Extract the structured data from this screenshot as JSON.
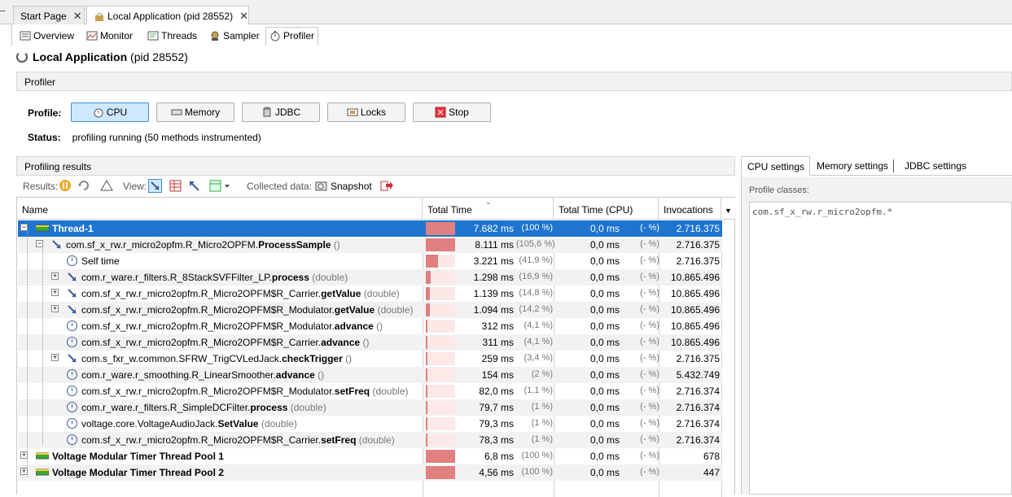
{
  "doc_tabs": [
    {
      "label": "Start Page",
      "close": "✕"
    },
    {
      "label": "Local Application (pid 28552)",
      "close": "✕"
    }
  ],
  "view_tabs": [
    "Overview",
    "Monitor",
    "Threads",
    "Sampler",
    "Profiler"
  ],
  "title": {
    "name": "Local Application",
    "pid": "(pid 28552)"
  },
  "profiler_section": "Profiler",
  "profile": {
    "label": "Profile:",
    "buttons": [
      "CPU",
      "Memory",
      "JDBC",
      "Locks",
      "Stop"
    ],
    "status_label": "Status:",
    "status_value": "profiling running (50 methods instrumented)"
  },
  "results_section": "Profiling results",
  "toolbar": {
    "results": "Results:",
    "view": "View:",
    "collected": "Collected data:",
    "snapshot": "Snapshot"
  },
  "settings_tabs": [
    "CPU settings",
    "Memory settings",
    "JDBC settings"
  ],
  "profile_classes_label": "Profile classes:",
  "profile_classes_value": "com.sf_x_rw.r_micro2opfm.*",
  "columns": [
    "Name",
    "Total Time",
    "Total Time (CPU)",
    "Invocations"
  ],
  "rows": [
    {
      "name": "Thread-1",
      "bold": "",
      "sig": "",
      "time": "7.682 ms",
      "pct": "(100 %)",
      "cpu": "0,0 ms",
      "cpct": "(- %)",
      "inv": "2.716.375",
      "fill": 1.0
    },
    {
      "name": "com.sf_x_rw.r_micro2opfm.R_Micro2OPFM.",
      "bold": "ProcessSample",
      "sig": " ()",
      "time": "8.111 ms",
      "pct": "(105,6 %)",
      "cpu": "0,0 ms",
      "cpct": "(- %)",
      "inv": "2.716.375",
      "fill": 1.0
    },
    {
      "name": "Self time",
      "bold": "",
      "sig": "",
      "time": "3.221 ms",
      "pct": "(41,9 %)",
      "cpu": "0,0 ms",
      "cpct": "(- %)",
      "inv": "2.716.375",
      "fill": 0.419
    },
    {
      "name": "com.r_ware.r_filters.R_8StackSVFFilter_LP.",
      "bold": "process",
      "sig": " (double)",
      "time": "1.298 ms",
      "pct": "(16,9 %)",
      "cpu": "0,0 ms",
      "cpct": "(- %)",
      "inv": "10.865.496",
      "fill": 0.169
    },
    {
      "name": "com.sf_x_rw.r_micro2opfm.R_Micro2OPFM$R_Carrier.",
      "bold": "getValue",
      "sig": " (double)",
      "time": "1.139 ms",
      "pct": "(14,8 %)",
      "cpu": "0,0 ms",
      "cpct": "(- %)",
      "inv": "10.865.496",
      "fill": 0.148
    },
    {
      "name": "com.sf_x_rw.r_micro2opfm.R_Micro2OPFM$R_Modulator.",
      "bold": "getValue",
      "sig": " (double)",
      "time": "1.094 ms",
      "pct": "(14,2 %)",
      "cpu": "0,0 ms",
      "cpct": "(- %)",
      "inv": "10.865.496",
      "fill": 0.142
    },
    {
      "name": "com.sf_x_rw.r_micro2opfm.R_Micro2OPFM$R_Modulator.",
      "bold": "advance",
      "sig": " ()",
      "time": "312 ms",
      "pct": "(4,1 %)",
      "cpu": "0,0 ms",
      "cpct": "(- %)",
      "inv": "10.865.496",
      "fill": 0.041
    },
    {
      "name": "com.sf_x_rw.r_micro2opfm.R_Micro2OPFM$R_Carrier.",
      "bold": "advance",
      "sig": " ()",
      "time": "311 ms",
      "pct": "(4,1 %)",
      "cpu": "0,0 ms",
      "cpct": "(- %)",
      "inv": "10.865.496",
      "fill": 0.041
    },
    {
      "name": "com.s_fxr_w.common.SFRW_TrigCVLedJack.",
      "bold": "checkTrigger",
      "sig": " ()",
      "time": "259 ms",
      "pct": "(3,4 %)",
      "cpu": "0,0 ms",
      "cpct": "(- %)",
      "inv": "2.716.375",
      "fill": 0.034
    },
    {
      "name": "com.r_ware.r_smoothing.R_LinearSmoother.",
      "bold": "advance",
      "sig": " ()",
      "time": "154 ms",
      "pct": "(2 %)",
      "cpu": "0,0 ms",
      "cpct": "(- %)",
      "inv": "5.432.749",
      "fill": 0.02
    },
    {
      "name": "com.sf_x_rw.r_micro2opfm.R_Micro2OPFM$R_Modulator.",
      "bold": "setFreq",
      "sig": " (double)",
      "time": "82,0 ms",
      "pct": "(1,1 %)",
      "cpu": "0,0 ms",
      "cpct": "(- %)",
      "inv": "2.716.374",
      "fill": 0.011
    },
    {
      "name": "com.r_ware.r_filters.R_SimpleDCFilter.",
      "bold": "process",
      "sig": " (double)",
      "time": "79,7 ms",
      "pct": "(1 %)",
      "cpu": "0,0 ms",
      "cpct": "(- %)",
      "inv": "2.716.374",
      "fill": 0.01
    },
    {
      "name": "voltage.core.VoltageAudioJack.",
      "bold": "SetValue",
      "sig": " (double)",
      "time": "79,3 ms",
      "pct": "(1 %)",
      "cpu": "0,0 ms",
      "cpct": "(- %)",
      "inv": "2.716.374",
      "fill": 0.01
    },
    {
      "name": "com.sf_x_rw.r_micro2opfm.R_Micro2OPFM$R_Carrier.",
      "bold": "setFreq",
      "sig": " (double)",
      "time": "78,3 ms",
      "pct": "(1 %)",
      "cpu": "0,0 ms",
      "cpct": "(- %)",
      "inv": "2.716.374",
      "fill": 0.01
    },
    {
      "name": "Voltage Modular Timer Thread Pool 1",
      "bold": "",
      "sig": "",
      "time": "6,8 ms",
      "pct": "(100 %)",
      "cpu": "0,0 ms",
      "cpct": "(- %)",
      "inv": "678",
      "fill": 1.0
    },
    {
      "name": "Voltage Modular Timer Thread Pool 2",
      "bold": "",
      "sig": "",
      "time": "4,56 ms",
      "pct": "(100 %)",
      "cpu": "0,0 ms",
      "cpct": "(- %)",
      "inv": "447",
      "fill": 1.0
    }
  ]
}
